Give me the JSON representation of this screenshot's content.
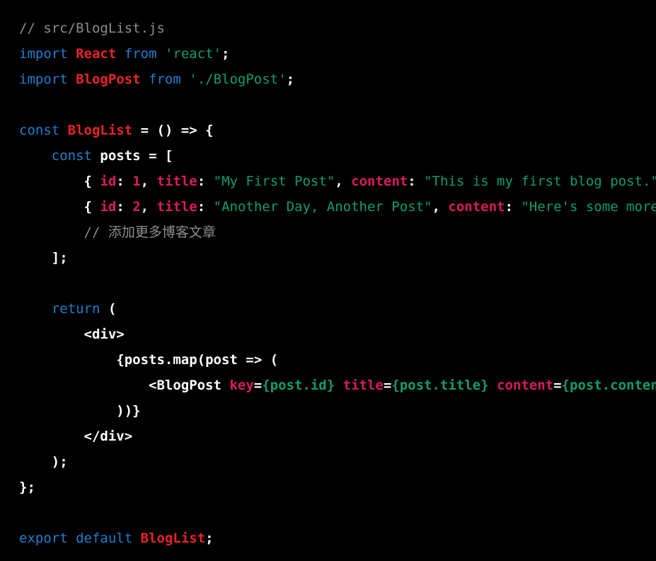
{
  "editor": {
    "background": "#000000",
    "font_size_px": 19,
    "line_height_px": 36,
    "language": "javascript-jsx",
    "filename": "src/BlogList.js",
    "colors": {
      "comment": "#8d8d8d",
      "keyword": "#1d7fd0",
      "type": "#e8232a",
      "string": "#0f9d6e",
      "property": "#d81b60",
      "attribute": "#d81b60",
      "plain": "#ffffff",
      "expression": "#0f9d6e"
    }
  },
  "code": {
    "lines": [
      {
        "index": 1,
        "text": "// src/BlogList.js",
        "tokens": [
          {
            "t": "// src/BlogList.js",
            "c": "t-comment"
          }
        ]
      },
      {
        "index": 2,
        "text": "import React from 'react';",
        "tokens": [
          {
            "t": "import",
            "c": "t-keyword"
          },
          {
            "t": " ",
            "c": "t-space"
          },
          {
            "t": "React",
            "c": "t-type"
          },
          {
            "t": " ",
            "c": "t-space"
          },
          {
            "t": "from",
            "c": "t-keyword"
          },
          {
            "t": " ",
            "c": "t-space"
          },
          {
            "t": "'react'",
            "c": "t-string"
          },
          {
            "t": ";",
            "c": "t-punct"
          }
        ]
      },
      {
        "index": 3,
        "text": "import BlogPost from './BlogPost';",
        "tokens": [
          {
            "t": "import",
            "c": "t-keyword"
          },
          {
            "t": " ",
            "c": "t-space"
          },
          {
            "t": "BlogPost",
            "c": "t-type"
          },
          {
            "t": " ",
            "c": "t-space"
          },
          {
            "t": "from",
            "c": "t-keyword"
          },
          {
            "t": " ",
            "c": "t-space"
          },
          {
            "t": "'./BlogPost'",
            "c": "t-string"
          },
          {
            "t": ";",
            "c": "t-punct"
          }
        ]
      },
      {
        "index": 4,
        "text": "",
        "tokens": []
      },
      {
        "index": 5,
        "text": "const BlogList = () => {",
        "tokens": [
          {
            "t": "const",
            "c": "t-keyword"
          },
          {
            "t": " ",
            "c": "t-space"
          },
          {
            "t": "BlogList",
            "c": "t-type"
          },
          {
            "t": " = () => {",
            "c": "t-plain"
          }
        ]
      },
      {
        "index": 6,
        "text": "    const posts = [",
        "tokens": [
          {
            "t": "    ",
            "c": "t-space"
          },
          {
            "t": "const",
            "c": "t-keyword"
          },
          {
            "t": " ",
            "c": "t-space"
          },
          {
            "t": "posts",
            "c": "t-plain"
          },
          {
            "t": " = [",
            "c": "t-plain"
          }
        ]
      },
      {
        "index": 7,
        "text": "        { id: 1, title: \"My First Post\", content: \"This is my first blo",
        "tokens": [
          {
            "t": "        ",
            "c": "t-space"
          },
          {
            "t": "{",
            "c": "t-plain"
          },
          {
            "t": " ",
            "c": "t-space"
          },
          {
            "t": "id",
            "c": "t-prop"
          },
          {
            "t": ": ",
            "c": "t-plain"
          },
          {
            "t": "1",
            "c": "t-number"
          },
          {
            "t": ", ",
            "c": "t-plain"
          },
          {
            "t": "title",
            "c": "t-prop"
          },
          {
            "t": ": ",
            "c": "t-plain"
          },
          {
            "t": "\"My First Post\"",
            "c": "t-string"
          },
          {
            "t": ", ",
            "c": "t-plain"
          },
          {
            "t": "content",
            "c": "t-prop"
          },
          {
            "t": ": ",
            "c": "t-plain"
          },
          {
            "t": "\"This is my first blog post.\" },",
            "c": "t-string"
          }
        ]
      },
      {
        "index": 8,
        "text": "        { id: 2, title: \"Another Day, Another Post\", content: \"Here's s",
        "tokens": [
          {
            "t": "        ",
            "c": "t-space"
          },
          {
            "t": "{",
            "c": "t-plain"
          },
          {
            "t": " ",
            "c": "t-space"
          },
          {
            "t": "id",
            "c": "t-prop"
          },
          {
            "t": ": ",
            "c": "t-plain"
          },
          {
            "t": "2",
            "c": "t-number"
          },
          {
            "t": ", ",
            "c": "t-plain"
          },
          {
            "t": "title",
            "c": "t-prop"
          },
          {
            "t": ": ",
            "c": "t-plain"
          },
          {
            "t": "\"Another Day, Another Post\"",
            "c": "t-string"
          },
          {
            "t": ", ",
            "c": "t-plain"
          },
          {
            "t": "content",
            "c": "t-prop"
          },
          {
            "t": ": ",
            "c": "t-plain"
          },
          {
            "t": "\"Here's some more content.\" },",
            "c": "t-string"
          }
        ]
      },
      {
        "index": 9,
        "text": "        // 添加更多博客文章",
        "tokens": [
          {
            "t": "        ",
            "c": "t-space"
          },
          {
            "t": "// 添加更多博客文章",
            "c": "t-comment"
          }
        ]
      },
      {
        "index": 10,
        "text": "    ];",
        "tokens": [
          {
            "t": "    ",
            "c": "t-space"
          },
          {
            "t": "];",
            "c": "t-plain"
          }
        ]
      },
      {
        "index": 11,
        "text": "",
        "tokens": []
      },
      {
        "index": 12,
        "text": "    return (",
        "tokens": [
          {
            "t": "    ",
            "c": "t-space"
          },
          {
            "t": "return",
            "c": "t-keyword"
          },
          {
            "t": " (",
            "c": "t-plain"
          }
        ]
      },
      {
        "index": 13,
        "text": "        <div>",
        "tokens": [
          {
            "t": "        ",
            "c": "t-space"
          },
          {
            "t": "<div>",
            "c": "t-tag"
          }
        ]
      },
      {
        "index": 14,
        "text": "            {posts.map(post => (",
        "tokens": [
          {
            "t": "            ",
            "c": "t-space"
          },
          {
            "t": "{posts.map(post => (",
            "c": "t-plain"
          }
        ]
      },
      {
        "index": 15,
        "text": "                <BlogPost key={post.id} title={post.title} content={pos",
        "tokens": [
          {
            "t": "                ",
            "c": "t-space"
          },
          {
            "t": "<BlogPost",
            "c": "t-tag"
          },
          {
            "t": " ",
            "c": "t-space"
          },
          {
            "t": "key",
            "c": "t-attr"
          },
          {
            "t": "=",
            "c": "t-plain"
          },
          {
            "t": "{post.id}",
            "c": "t-expr"
          },
          {
            "t": " ",
            "c": "t-space"
          },
          {
            "t": "title",
            "c": "t-attr"
          },
          {
            "t": "=",
            "c": "t-plain"
          },
          {
            "t": "{post.title}",
            "c": "t-expr"
          },
          {
            "t": " ",
            "c": "t-space"
          },
          {
            "t": "content",
            "c": "t-attr"
          },
          {
            "t": "=",
            "c": "t-plain"
          },
          {
            "t": "{post.content}",
            "c": "t-expr"
          },
          {
            "t": " />",
            "c": "t-tag"
          }
        ]
      },
      {
        "index": 16,
        "text": "            ))}",
        "tokens": [
          {
            "t": "            ",
            "c": "t-space"
          },
          {
            "t": "))}",
            "c": "t-plain"
          }
        ]
      },
      {
        "index": 17,
        "text": "        </div>",
        "tokens": [
          {
            "t": "        ",
            "c": "t-space"
          },
          {
            "t": "</div>",
            "c": "t-tag"
          }
        ]
      },
      {
        "index": 18,
        "text": "    );",
        "tokens": [
          {
            "t": "    ",
            "c": "t-space"
          },
          {
            "t": ");",
            "c": "t-plain"
          }
        ]
      },
      {
        "index": 19,
        "text": "};",
        "tokens": [
          {
            "t": "};",
            "c": "t-plain"
          }
        ]
      },
      {
        "index": 20,
        "text": "",
        "tokens": []
      },
      {
        "index": 21,
        "text": "export default BlogList;",
        "tokens": [
          {
            "t": "export",
            "c": "t-keyword"
          },
          {
            "t": " ",
            "c": "t-space"
          },
          {
            "t": "default",
            "c": "t-keyword"
          },
          {
            "t": " ",
            "c": "t-space"
          },
          {
            "t": "BlogList",
            "c": "t-type"
          },
          {
            "t": ";",
            "c": "t-punct"
          }
        ]
      }
    ]
  }
}
